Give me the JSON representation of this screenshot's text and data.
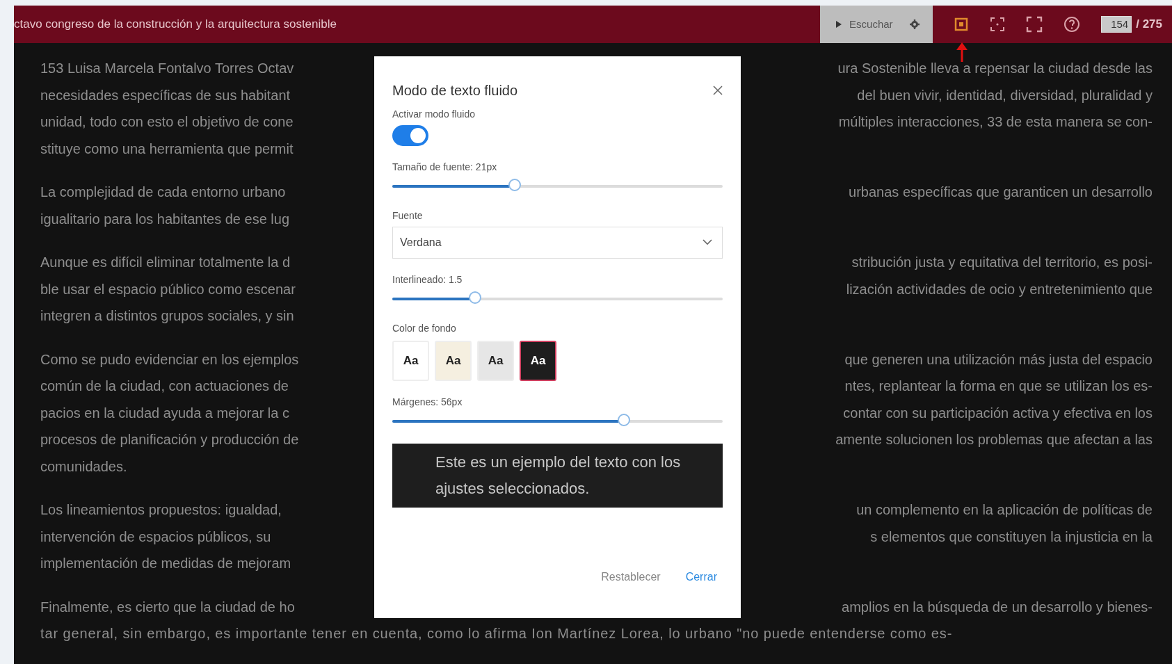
{
  "top_bar": {
    "title": "ctavo congreso de la construcción y la arquitectura sostenible",
    "listen_button": "Escuchar",
    "fluid_mode_active": true,
    "page_input": "154",
    "page_total": "/ 275"
  },
  "paragraphs": [
    {
      "lines": [
        {
          "left": "153 Luisa Marcela Fontalvo Torres Octav",
          "right": "ura Sostenible lleva a repensar la ciudad desde las"
        },
        {
          "left": "necesidades específicas de sus habitant",
          "right": "del buen vivir, identidad, diversidad, pluralidad y"
        },
        {
          "left": "unidad, todo con esto el objetivo de cone",
          "right": "múltiples interacciones, 33 de esta manera se con-"
        },
        {
          "left": "stituye como una herramienta que permit"
        }
      ]
    },
    {
      "lines": [
        {
          "left": "La complejidad de cada entorno urbano",
          "right": "urbanas específicas que garanticen un desarrollo"
        },
        {
          "left": "igualitario para los habitantes de ese lug"
        }
      ]
    },
    {
      "lines": [
        {
          "left": "Aunque es difícil eliminar totalmente la d",
          "right": "stribución justa y equitativa del territorio, es posi-"
        },
        {
          "left": "ble usar el espacio público como escenar",
          "right": "lización actividades de ocio y entretenimiento que"
        },
        {
          "left": "integren a distintos grupos sociales, y sin"
        }
      ]
    },
    {
      "lines": [
        {
          "left": "Como se pudo evidenciar en los ejemplos",
          "right": "que generen una utilización más justa del espacio"
        },
        {
          "left": "común de la ciudad, con actuaciones de",
          "right": "ntes, replantear la forma en que se utilizan los es-"
        },
        {
          "left": "pacios en la ciudad ayuda a mejorar la c",
          "right": "contar con su participación activa y efectiva en los"
        },
        {
          "left": "procesos de planificación y producción de",
          "right": "amente solucionen los problemas que afectan a las"
        },
        {
          "left": "comunidades."
        }
      ]
    },
    {
      "lines": [
        {
          "left": "Los lineamientos propuestos: igualdad,",
          "right": "un complemento en la aplicación de políticas de"
        },
        {
          "left": "intervención de espacios públicos, su",
          "right": "s elementos que constituyen la injusticia en la"
        },
        {
          "left": "implementación de medidas de mejoram"
        }
      ]
    },
    {
      "lines": [
        {
          "left": "Finalmente, es cierto que la ciudad de ho",
          "right": "amplios en la búsqueda de un desarrollo y bienes-"
        },
        {
          "full": "tar general, sin embargo, es importante tener en cuenta, como lo afirma Ion Martínez Lorea, lo urbano \"no puede entenderse como es-"
        }
      ]
    }
  ],
  "dialog": {
    "title": "Modo de texto fluido",
    "toggle": {
      "label": "Activar modo fluido",
      "on": true
    },
    "font_size": {
      "label": "Tamaño de fuente: 21px",
      "level": 0.37
    },
    "font": {
      "label": "Fuente",
      "value": "Verdana"
    },
    "line_height": {
      "label": "Interlineado: 1.5",
      "level": 0.25
    },
    "background": {
      "label": "Color de fondo",
      "swatches": [
        {
          "text": "Aa",
          "color": "#ffffff",
          "selected": false
        },
        {
          "text": "Aa",
          "color": "#f5efe0",
          "selected": false
        },
        {
          "text": "Aa",
          "color": "#e6e6e6",
          "selected": false
        },
        {
          "text": "Aa",
          "color": "#1e1e1e",
          "selected": true
        }
      ]
    },
    "margins": {
      "label": "Márgenes: 56px",
      "level": 0.7
    },
    "preview": "Este es un ejemplo del texto con los ajustes seleccionados.",
    "buttons": [
      {
        "label": "Restablecer",
        "kind": "secondary"
      },
      {
        "label": "Cerrar",
        "kind": "primary"
      }
    ]
  }
}
